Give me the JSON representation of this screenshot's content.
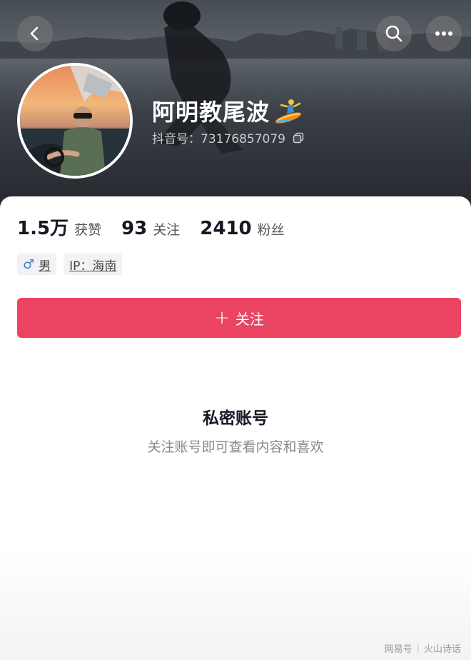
{
  "header": {
    "nickname": "阿明教尾波",
    "douyin_id": "抖音号：73176857079",
    "icons": [
      "back-icon",
      "search-icon",
      "more-icon",
      "surfing-emoji",
      "copy-icon"
    ]
  },
  "stats": [
    {
      "value": "1.5万",
      "label": "获赞"
    },
    {
      "value": "93",
      "label": "关注"
    },
    {
      "value": "2410",
      "label": "粉丝"
    }
  ],
  "tags": {
    "gender": "男",
    "ip": "IP：海南"
  },
  "follow_button": {
    "label": "关注",
    "color": "#ea4462"
  },
  "private": {
    "title": "私密账号",
    "description": "关注账号即可查看内容和喜欢"
  },
  "watermark": {
    "left": "网易号",
    "right": "火山诗话"
  }
}
